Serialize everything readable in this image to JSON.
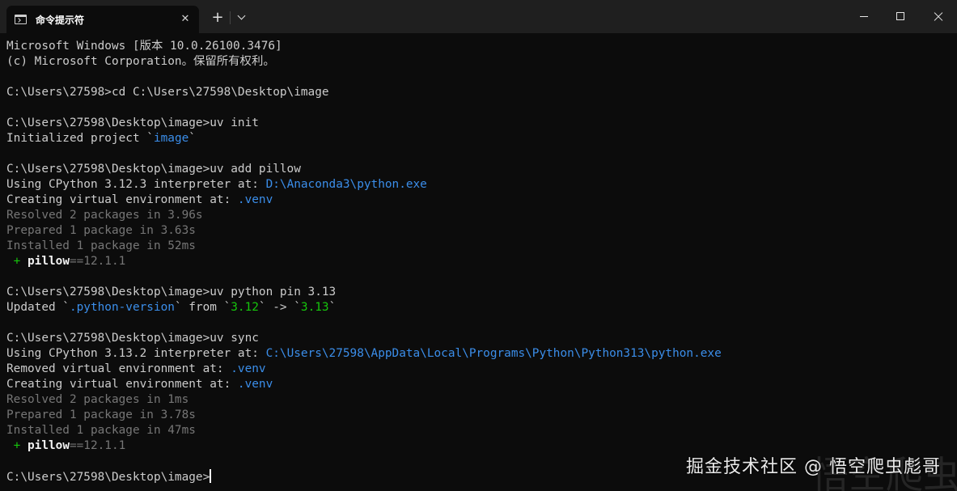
{
  "titlebar": {
    "tab_title": "命令提示符",
    "tab_close_glyph": "✕",
    "new_tab_glyph": "+"
  },
  "terminal": {
    "lines": [
      {
        "segments": [
          {
            "text": "Microsoft Windows [版本 10.0.26100.3476]",
            "style": "normal"
          }
        ]
      },
      {
        "segments": [
          {
            "text": "(c) Microsoft Corporation。保留所有权利。",
            "style": "normal"
          }
        ]
      },
      {
        "segments": []
      },
      {
        "segments": [
          {
            "text": "C:\\Users\\27598>cd C:\\Users\\27598\\Desktop\\image",
            "style": "normal"
          }
        ]
      },
      {
        "segments": []
      },
      {
        "segments": [
          {
            "text": "C:\\Users\\27598\\Desktop\\image>uv init",
            "style": "normal"
          }
        ]
      },
      {
        "segments": [
          {
            "text": "Initialized project `",
            "style": "normal"
          },
          {
            "text": "image",
            "style": "hl"
          },
          {
            "text": "`",
            "style": "normal"
          }
        ]
      },
      {
        "segments": []
      },
      {
        "segments": [
          {
            "text": "C:\\Users\\27598\\Desktop\\image>uv add pillow",
            "style": "normal"
          }
        ]
      },
      {
        "segments": [
          {
            "text": "Using CPython 3.12.3 interpreter at: ",
            "style": "normal"
          },
          {
            "text": "D:\\Anaconda3\\python.exe",
            "style": "hl"
          }
        ]
      },
      {
        "segments": [
          {
            "text": "Creating virtual environment at: ",
            "style": "normal"
          },
          {
            "text": ".venv",
            "style": "hl"
          }
        ]
      },
      {
        "segments": [
          {
            "text": "Resolved 2 packages in 3.96s",
            "style": "dim"
          }
        ]
      },
      {
        "segments": [
          {
            "text": "Prepared 1 package in 3.63s",
            "style": "dim"
          }
        ]
      },
      {
        "segments": [
          {
            "text": "Installed 1 package in 52ms",
            "style": "dim"
          }
        ]
      },
      {
        "segments": [
          {
            "text": " + ",
            "style": "grn"
          },
          {
            "text": "pillow",
            "style": "bold"
          },
          {
            "text": "==12.1.1",
            "style": "dim"
          }
        ]
      },
      {
        "segments": []
      },
      {
        "segments": [
          {
            "text": "C:\\Users\\27598\\Desktop\\image>uv python pin 3.13",
            "style": "normal"
          }
        ]
      },
      {
        "segments": [
          {
            "text": "Updated `",
            "style": "normal"
          },
          {
            "text": ".python-version",
            "style": "hl"
          },
          {
            "text": "` from `",
            "style": "normal"
          },
          {
            "text": "3.12",
            "style": "grn"
          },
          {
            "text": "` -> `",
            "style": "normal"
          },
          {
            "text": "3.13",
            "style": "grn"
          },
          {
            "text": "`",
            "style": "normal"
          }
        ]
      },
      {
        "segments": []
      },
      {
        "segments": [
          {
            "text": "C:\\Users\\27598\\Desktop\\image>uv sync",
            "style": "normal"
          }
        ]
      },
      {
        "segments": [
          {
            "text": "Using CPython 3.13.2 interpreter at: ",
            "style": "normal"
          },
          {
            "text": "C:\\Users\\27598\\AppData\\Local\\Programs\\Python\\Python313\\python.exe",
            "style": "hl"
          }
        ]
      },
      {
        "segments": [
          {
            "text": "Removed virtual environment at: ",
            "style": "normal"
          },
          {
            "text": ".venv",
            "style": "hl"
          }
        ]
      },
      {
        "segments": [
          {
            "text": "Creating virtual environment at: ",
            "style": "normal"
          },
          {
            "text": ".venv",
            "style": "hl"
          }
        ]
      },
      {
        "segments": [
          {
            "text": "Resolved 2 packages in 1ms",
            "style": "dim"
          }
        ]
      },
      {
        "segments": [
          {
            "text": "Prepared 1 package in 3.78s",
            "style": "dim"
          }
        ]
      },
      {
        "segments": [
          {
            "text": "Installed 1 package in 47ms",
            "style": "dim"
          }
        ]
      },
      {
        "segments": [
          {
            "text": " + ",
            "style": "grn"
          },
          {
            "text": "pillow",
            "style": "bold"
          },
          {
            "text": "==12.1.1",
            "style": "dim"
          }
        ]
      },
      {
        "segments": []
      },
      {
        "segments": [
          {
            "text": "C:\\Users\\27598\\Desktop\\image>",
            "style": "normal"
          }
        ],
        "cursor": true
      }
    ]
  },
  "watermark": {
    "text": "掘金技术社区 @ 悟空爬虫彪哥",
    "ghost_text": "悟空爬虫"
  },
  "colors": {
    "background": "#0c0c0c",
    "titlebar": "#1f1f1f",
    "text": "#cccccc",
    "highlight_blue": "#3b8eea",
    "green": "#16c60c",
    "dim_gray": "#767676"
  },
  "icons": {
    "tab_icon": "terminal-icon",
    "minimize": "minimize-icon",
    "maximize": "maximize-icon",
    "close": "close-icon",
    "dropdown": "chevron-down-icon"
  }
}
